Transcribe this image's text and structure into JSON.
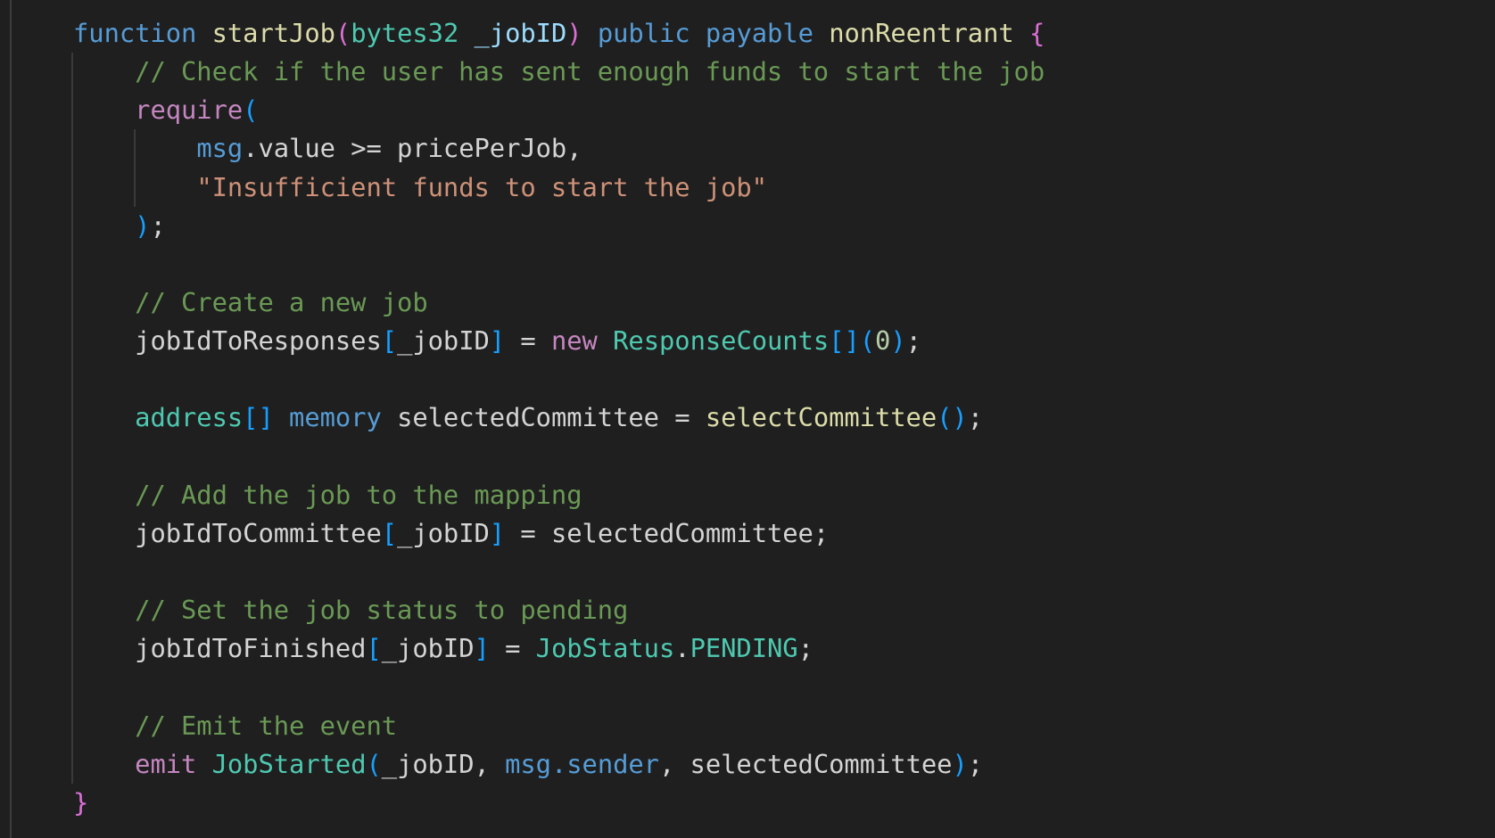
{
  "editor": {
    "language": "solidity",
    "theme_colors": {
      "background": "#1f1f1f",
      "default": "#d4d4d4",
      "keyword": "#569cd6",
      "function_name": "#dcdcaa",
      "type": "#4ec9b0",
      "parameter": "#9cdcfe",
      "bracket_level1": "#da70d6",
      "bracket_level2": "#179fff",
      "comment": "#6a9955",
      "string": "#ce9178",
      "control": "#c586c0",
      "number": "#b5cea8"
    },
    "lines": [
      {
        "indent": 0,
        "tokens": [
          {
            "t": "function",
            "c": "keyword"
          },
          {
            "t": " ",
            "c": "default"
          },
          {
            "t": "startJob",
            "c": "fn"
          },
          {
            "t": "(",
            "c": "brace1"
          },
          {
            "t": "bytes32",
            "c": "type"
          },
          {
            "t": " ",
            "c": "default"
          },
          {
            "t": "_jobID",
            "c": "param"
          },
          {
            "t": ")",
            "c": "brace1"
          },
          {
            "t": " ",
            "c": "default"
          },
          {
            "t": "public",
            "c": "keyword"
          },
          {
            "t": " ",
            "c": "default"
          },
          {
            "t": "payable",
            "c": "keyword"
          },
          {
            "t": " ",
            "c": "default"
          },
          {
            "t": "nonReentrant",
            "c": "fn"
          },
          {
            "t": " ",
            "c": "default"
          },
          {
            "t": "{",
            "c": "brace1"
          }
        ]
      },
      {
        "indent": 1,
        "tokens": [
          {
            "t": "// Check if the user has sent enough funds to start the job",
            "c": "comment"
          }
        ]
      },
      {
        "indent": 1,
        "tokens": [
          {
            "t": "require",
            "c": "control"
          },
          {
            "t": "(",
            "c": "brace2"
          }
        ]
      },
      {
        "indent": 2,
        "tokens": [
          {
            "t": "msg",
            "c": "keyword"
          },
          {
            "t": ".value >= pricePerJob,",
            "c": "default"
          }
        ]
      },
      {
        "indent": 2,
        "tokens": [
          {
            "t": "\"Insufficient funds to start the job\"",
            "c": "string"
          }
        ]
      },
      {
        "indent": 1,
        "tokens": [
          {
            "t": ")",
            "c": "brace2"
          },
          {
            "t": ";",
            "c": "default"
          }
        ]
      },
      {
        "indent": 0,
        "tokens": []
      },
      {
        "indent": 1,
        "tokens": [
          {
            "t": "// Create a new job",
            "c": "comment"
          }
        ]
      },
      {
        "indent": 1,
        "tokens": [
          {
            "t": "jobIdToResponses",
            "c": "default"
          },
          {
            "t": "[",
            "c": "brace2"
          },
          {
            "t": "_jobID",
            "c": "default"
          },
          {
            "t": "]",
            "c": "brace2"
          },
          {
            "t": " = ",
            "c": "default"
          },
          {
            "t": "new",
            "c": "control"
          },
          {
            "t": " ",
            "c": "default"
          },
          {
            "t": "ResponseCounts",
            "c": "type"
          },
          {
            "t": "[]",
            "c": "brace2"
          },
          {
            "t": "(",
            "c": "brace2"
          },
          {
            "t": "0",
            "c": "number"
          },
          {
            "t": ")",
            "c": "brace2"
          },
          {
            "t": ";",
            "c": "default"
          }
        ]
      },
      {
        "indent": 0,
        "tokens": []
      },
      {
        "indent": 1,
        "tokens": [
          {
            "t": "address",
            "c": "type"
          },
          {
            "t": "[]",
            "c": "brace2"
          },
          {
            "t": " ",
            "c": "default"
          },
          {
            "t": "memory",
            "c": "keyword"
          },
          {
            "t": " selectedCommittee = ",
            "c": "default"
          },
          {
            "t": "selectCommittee",
            "c": "fn"
          },
          {
            "t": "()",
            "c": "brace2"
          },
          {
            "t": ";",
            "c": "default"
          }
        ]
      },
      {
        "indent": 0,
        "tokens": []
      },
      {
        "indent": 1,
        "tokens": [
          {
            "t": "// Add the job to the mapping",
            "c": "comment"
          }
        ]
      },
      {
        "indent": 1,
        "tokens": [
          {
            "t": "jobIdToCommittee",
            "c": "default"
          },
          {
            "t": "[",
            "c": "brace2"
          },
          {
            "t": "_jobID",
            "c": "default"
          },
          {
            "t": "]",
            "c": "brace2"
          },
          {
            "t": " = selectedCommittee;",
            "c": "default"
          }
        ]
      },
      {
        "indent": 0,
        "tokens": []
      },
      {
        "indent": 1,
        "tokens": [
          {
            "t": "// Set the job status to pending",
            "c": "comment"
          }
        ]
      },
      {
        "indent": 1,
        "tokens": [
          {
            "t": "jobIdToFinished",
            "c": "default"
          },
          {
            "t": "[",
            "c": "brace2"
          },
          {
            "t": "_jobID",
            "c": "default"
          },
          {
            "t": "]",
            "c": "brace2"
          },
          {
            "t": " = ",
            "c": "default"
          },
          {
            "t": "JobStatus",
            "c": "type"
          },
          {
            "t": ".",
            "c": "default"
          },
          {
            "t": "PENDING",
            "c": "type"
          },
          {
            "t": ";",
            "c": "default"
          }
        ]
      },
      {
        "indent": 0,
        "tokens": []
      },
      {
        "indent": 1,
        "tokens": [
          {
            "t": "// Emit the event",
            "c": "comment"
          }
        ]
      },
      {
        "indent": 1,
        "tokens": [
          {
            "t": "emit",
            "c": "control"
          },
          {
            "t": " ",
            "c": "default"
          },
          {
            "t": "JobStarted",
            "c": "type"
          },
          {
            "t": "(",
            "c": "brace2"
          },
          {
            "t": "_jobID, ",
            "c": "default"
          },
          {
            "t": "msg.sender",
            "c": "keyword"
          },
          {
            "t": ", selectedCommittee",
            "c": "default"
          },
          {
            "t": ")",
            "c": "brace2"
          },
          {
            "t": ";",
            "c": "default"
          }
        ]
      },
      {
        "indent": 0,
        "tokens": [
          {
            "t": "}",
            "c": "brace1"
          }
        ]
      }
    ]
  }
}
